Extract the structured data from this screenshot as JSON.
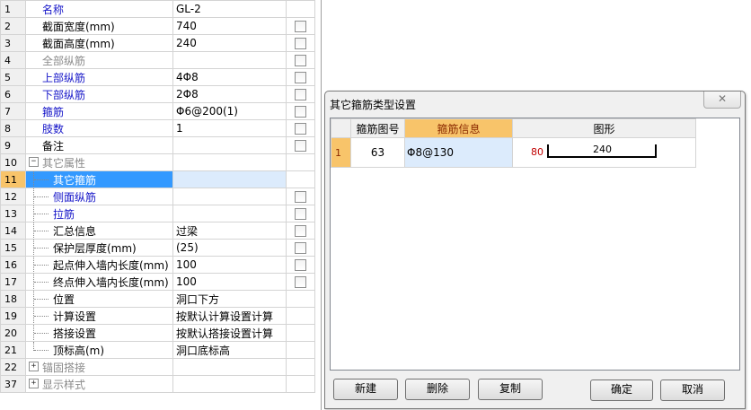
{
  "grid": {
    "rows": [
      {
        "no": "1",
        "name": "名称",
        "value": "GL-2",
        "color": "blue",
        "check": false,
        "indent": 0
      },
      {
        "no": "2",
        "name": "截面宽度(mm)",
        "value": "740",
        "color": "black",
        "check": true,
        "indent": 0
      },
      {
        "no": "3",
        "name": "截面高度(mm)",
        "value": "240",
        "color": "black",
        "check": true,
        "indent": 0
      },
      {
        "no": "4",
        "name": "全部纵筋",
        "value": "",
        "color": "gray",
        "check": true,
        "indent": 0
      },
      {
        "no": "5",
        "name": "上部纵筋",
        "value": "4Φ8",
        "color": "blue",
        "check": true,
        "indent": 0
      },
      {
        "no": "6",
        "name": "下部纵筋",
        "value": "2Φ8",
        "color": "blue",
        "check": true,
        "indent": 0
      },
      {
        "no": "7",
        "name": "箍筋",
        "value": "Φ6@200(1)",
        "color": "blue",
        "check": true,
        "indent": 0
      },
      {
        "no": "8",
        "name": "肢数",
        "value": "1",
        "color": "blue",
        "check": true,
        "indent": 0
      },
      {
        "no": "9",
        "name": "备注",
        "value": "",
        "color": "black",
        "check": true,
        "indent": 0
      },
      {
        "no": "10",
        "name": "其它属性",
        "value": "",
        "color": "gray",
        "check": false,
        "indent": 1,
        "expander": "−"
      },
      {
        "no": "11",
        "name": "其它箍筋",
        "value": "",
        "color": "blue",
        "check": false,
        "indent": 2,
        "selected": true
      },
      {
        "no": "12",
        "name": "侧面纵筋",
        "value": "",
        "color": "blue",
        "check": true,
        "indent": 2
      },
      {
        "no": "13",
        "name": "拉筋",
        "value": "",
        "color": "blue",
        "check": true,
        "indent": 2
      },
      {
        "no": "14",
        "name": "汇总信息",
        "value": "过梁",
        "color": "black",
        "check": true,
        "indent": 2
      },
      {
        "no": "15",
        "name": "保护层厚度(mm)",
        "value": "(25)",
        "color": "black",
        "check": true,
        "indent": 2
      },
      {
        "no": "16",
        "name": "起点伸入墙内长度(mm)",
        "value": "100",
        "color": "black",
        "check": true,
        "indent": 2
      },
      {
        "no": "17",
        "name": "终点伸入墙内长度(mm)",
        "value": "100",
        "color": "black",
        "check": true,
        "indent": 2
      },
      {
        "no": "18",
        "name": "位置",
        "value": "洞口下方",
        "color": "black",
        "check": false,
        "indent": 2
      },
      {
        "no": "19",
        "name": "计算设置",
        "value": "按默认计算设置计算",
        "color": "black",
        "check": false,
        "indent": 2
      },
      {
        "no": "20",
        "name": "搭接设置",
        "value": "按默认搭接设置计算",
        "color": "black",
        "check": false,
        "indent": 2
      },
      {
        "no": "21",
        "name": "顶标高(m)",
        "value": "洞口底标高",
        "color": "black",
        "check": false,
        "indent": 2,
        "last": true
      },
      {
        "no": "22",
        "name": "锚固搭接",
        "value": "",
        "color": "gray",
        "check": false,
        "indent": 1,
        "expander": "+"
      },
      {
        "no": "37",
        "name": "显示样式",
        "value": "",
        "color": "gray",
        "check": false,
        "indent": 1,
        "expander": "+"
      }
    ]
  },
  "dialog": {
    "title": "其它箍筋类型设置",
    "close": "✕",
    "headers": [
      "箍筋图号",
      "箍筋信息",
      "图形"
    ],
    "rows": [
      {
        "no": "1",
        "code": "63",
        "info": "Φ8@130",
        "shape_left": "80",
        "shape_mid": "240"
      }
    ],
    "buttons": {
      "new": "新建",
      "delete": "删除",
      "copy": "复制",
      "ok": "确定",
      "cancel": "取消"
    }
  }
}
